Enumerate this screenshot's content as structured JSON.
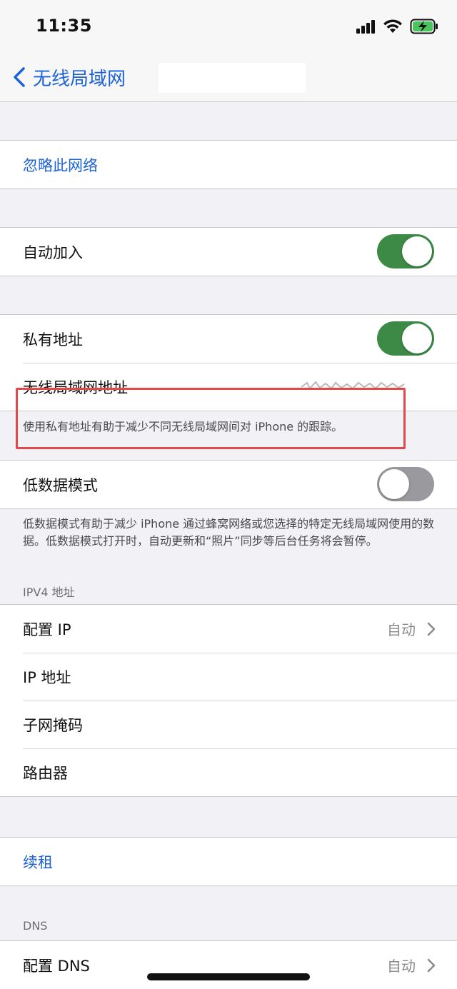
{
  "status_bar": {
    "time": "11:35"
  },
  "nav": {
    "back_label": "无线局域网"
  },
  "groups": {
    "forget": {
      "label": "忽略此网络"
    },
    "auto_join": {
      "label": "自动加入",
      "toggle_on": true
    },
    "private": {
      "private_address_label": "私有地址",
      "private_address_on": true,
      "wlan_address_label": "无线局域网地址",
      "footer": "使用私有地址有助于减少不同无线局域网间对 iPhone 的跟踪。"
    },
    "low_data": {
      "label": "低数据模式",
      "toggle_on": false,
      "footer": "低数据模式有助于减少 iPhone 通过蜂窝网络或您选择的特定无线局域网使用的数据。低数据模式打开时，自动更新和“照片”同步等后台任务将会暂停。"
    },
    "ipv4": {
      "header": "IPV4 地址",
      "configure_ip_label": "配置 IP",
      "configure_ip_value": "自动",
      "ip_address_label": "IP 地址",
      "subnet_mask_label": "子网掩码",
      "router_label": "路由器"
    },
    "renew": {
      "label": "续租"
    },
    "dns": {
      "header": "DNS",
      "configure_dns_label": "配置 DNS",
      "configure_dns_value": "自动"
    }
  },
  "colors": {
    "accent_blue": "#1c62d8",
    "toggle_on": "#3d8a47",
    "toggle_off": "#9a9a9e",
    "highlight_red": "#e24a4a"
  }
}
